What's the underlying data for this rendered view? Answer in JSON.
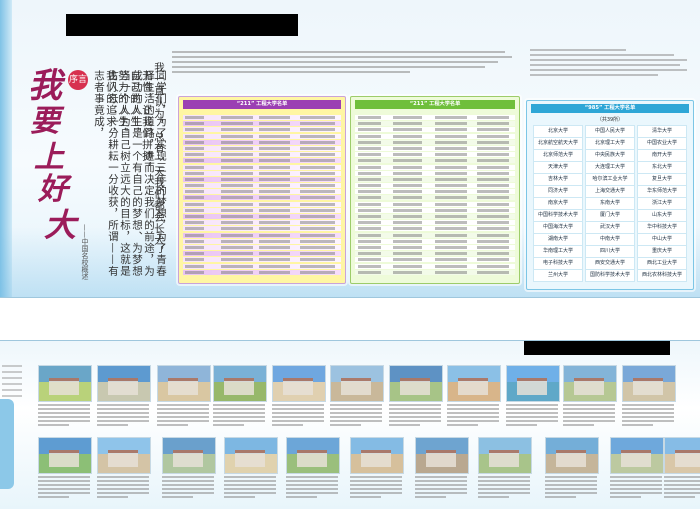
{
  "poster": {
    "title_calligraphy": "我要上好大学",
    "seal_text": "序言",
    "vertical_lines": [
      "我一直认为，总有一天我们都会长大，",
      "同学们，为了实现三年的梦想，为了青春无悔，让我们拼搏，",
      "择生活的道路，进而决定我们的前途，为自己的人生，",
      "成功的人生是一个有自己的梦想、为梦想努力的人生。",
      "当一个人为自己树立远大的目标，这就是我们的追求，",
      "古人云：一分耕耘一分收获，所谓——有志者事竟成，"
    ],
    "signature": "——中国名校概述",
    "intro_heading": "“211工程”是面向21世纪、重点建设100所左右的高等学校和一批重点学科的建设工程",
    "cards": {
      "c211": {
        "title": "“211” 工程大学名单"
      },
      "check": {
        "title": "“211” 工程大学名单"
      },
      "c985": {
        "title": "“985” 工程大学名单",
        "count": "（共39所）",
        "cells": [
          "北京大学",
          "中国人民大学",
          "清华大学",
          "北京航空航天大学",
          "北京理工大学",
          "中国农业大学",
          "北京师范大学",
          "中央民族大学",
          "南开大学",
          "天津大学",
          "大连理工大学",
          "东北大学",
          "吉林大学",
          "哈尔滨工业大学",
          "复旦大学",
          "同济大学",
          "上海交通大学",
          "华东师范大学",
          "南京大学",
          "东南大学",
          "浙江大学",
          "中国科学技术大学",
          "厦门大学",
          "山东大学",
          "中国海洋大学",
          "武汉大学",
          "华中科技大学",
          "湖南大学",
          "中南大学",
          "中山大学",
          "华南理工大学",
          "四川大学",
          "重庆大学",
          "电子科技大学",
          "西安交通大学",
          "西北工业大学",
          "兰州大学",
          "国防科学技术大学",
          "西北农林科技大学"
        ]
      }
    },
    "note985_title": "“985”工程大学名单"
  },
  "colors": {
    "accent_purple": "#9b3fb3",
    "accent_green": "#6fbf3b",
    "accent_blue": "#2ea6d6",
    "calligraphy": "#9b1c5a"
  },
  "bottom": {
    "photo_count": 22
  }
}
